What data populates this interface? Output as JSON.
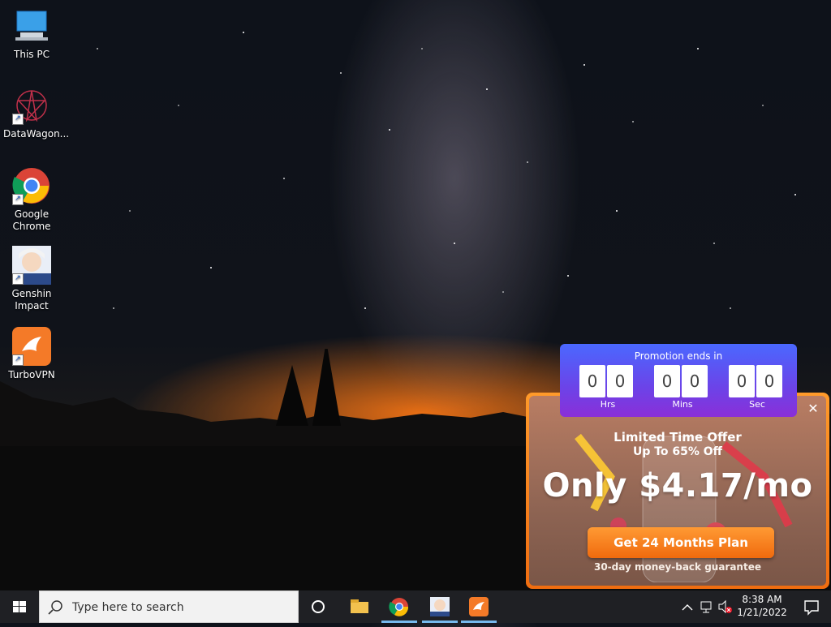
{
  "desktop": {
    "icons": [
      {
        "label": "This PC",
        "icon": "computer-icon"
      },
      {
        "label": "DataWagon...",
        "icon": "datawagon-icon"
      },
      {
        "label": "Google Chrome",
        "icon": "chrome-icon"
      },
      {
        "label": "Genshin Impact",
        "icon": "genshin-icon"
      },
      {
        "label": "TurboVPN",
        "icon": "turbovpn-icon"
      }
    ]
  },
  "promo": {
    "countdown_title": "Promotion ends in",
    "hours": [
      "0",
      "0"
    ],
    "minutes": [
      "0",
      "0"
    ],
    "seconds": [
      "0",
      "0"
    ],
    "labels": {
      "hrs": "Hrs",
      "mins": "Mins",
      "sec": "Sec"
    },
    "offer_title": "Limited Time Offer",
    "offer_sub": "Up To 65% Off",
    "price": "Only $4.17/mo",
    "cta": "Get 24 Months Plan",
    "guarantee": "30-day money-back guarantee",
    "close": "✕",
    "colors": {
      "orange": "#f07a1a",
      "purple": "#6c43e8",
      "blue": "#4a68ff"
    }
  },
  "taskbar": {
    "search_placeholder": "Type here to search",
    "apps": [
      "task-view-icon",
      "file-explorer-icon",
      "chrome-icon",
      "genshin-icon",
      "turbovpn-icon"
    ],
    "time": "8:38 AM",
    "date": "1/21/2022"
  }
}
